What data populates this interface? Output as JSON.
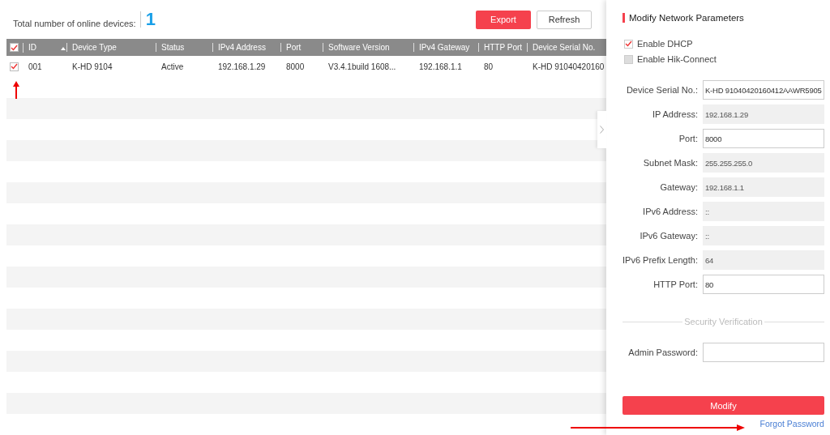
{
  "summary": {
    "label": "Total number of online devices:",
    "count": "1"
  },
  "toolbar": {
    "buttons": [
      {
        "label": "Export",
        "kind": "primary"
      },
      {
        "label": "Refresh",
        "kind": "plain"
      }
    ]
  },
  "table": {
    "select_all_checked": true,
    "columns": [
      "ID",
      "Device Type",
      "Status",
      "IPv4 Address",
      "Port",
      "Software Version",
      "IPv4 Gateway",
      "HTTP Port",
      "Device Serial No."
    ],
    "rows": [
      {
        "checked": true,
        "cells": [
          "001",
          "K-HD 9104",
          "Active",
          "192.168.1.29",
          "8000",
          "V3.4.1build 1608...",
          "192.168.1.1",
          "80",
          "K-HD 91040420160"
        ]
      }
    ]
  },
  "panel": {
    "title": "Modify Network Parameters",
    "options": [
      {
        "label": "Enable DHCP",
        "checked": true,
        "disabled": false
      },
      {
        "label": "Enable Hik-Connect",
        "checked": false,
        "disabled": true
      }
    ],
    "fields": [
      {
        "label": "Device Serial No.:",
        "value": "K-HD 91040420160412AAWR5905",
        "readonly": false
      },
      {
        "label": "IP Address:",
        "value": "192.168.1.29",
        "readonly": true
      },
      {
        "label": "Port:",
        "value": "8000",
        "readonly": false
      },
      {
        "label": "Subnet Mask:",
        "value": "255.255.255.0",
        "readonly": true
      },
      {
        "label": "Gateway:",
        "value": "192.168.1.1",
        "readonly": true
      },
      {
        "label": "IPv6 Address:",
        "value": "::",
        "readonly": true
      },
      {
        "label": "IPv6 Gateway:",
        "value": "::",
        "readonly": true
      },
      {
        "label": "IPv6 Prefix Length:",
        "value": "64",
        "readonly": true
      },
      {
        "label": "HTTP Port:",
        "value": "80",
        "readonly": false
      }
    ],
    "section": "Security Verification",
    "password_label": "Admin Password:",
    "submit": "Modify",
    "link": "Forgot Password"
  }
}
